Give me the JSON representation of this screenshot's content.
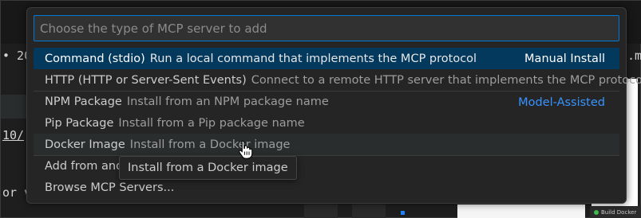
{
  "background": {
    "fragment_top": "• 20",
    "fragment_top_right": ".m",
    "fragment_path": "10/",
    "fragment_or": "or v",
    "status_text": "Build Docker"
  },
  "quick_pick": {
    "placeholder": "Choose the type of MCP server to add",
    "items": [
      {
        "label": "Command (stdio)",
        "description": "Run a local command that implements the MCP protocol",
        "right": "Manual Install"
      },
      {
        "label": "HTTP (HTTP or Server-Sent Events)",
        "description": "Connect to a remote HTTP server that implements the MCP protocol",
        "right": ""
      },
      {
        "label": "NPM Package",
        "description": "Install from an NPM package name",
        "right": "Model-Assisted"
      },
      {
        "label": "Pip Package",
        "description": "Install from a Pip package name",
        "right": ""
      },
      {
        "label": "Docker Image",
        "description": "Install from a Docker image",
        "right": ""
      },
      {
        "label": "Add from and",
        "description": "",
        "right": ""
      },
      {
        "label": "Browse MCP Servers...",
        "description": "",
        "right": ""
      }
    ]
  },
  "tooltip": {
    "text": "Install from a Docker image"
  },
  "colors": {
    "accent": "#0078d4",
    "selected_bg": "#04395e",
    "link": "#3794ff"
  },
  "icons": {
    "cursor": "hand-pointer-icon"
  }
}
